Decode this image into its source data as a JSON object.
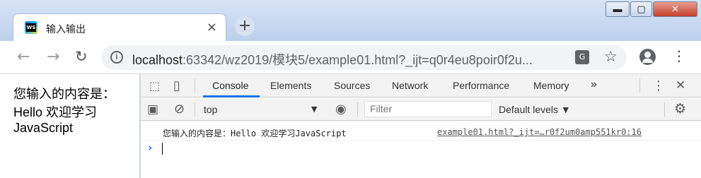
{
  "tab": {
    "title": "输入输出",
    "close": "×"
  },
  "window_controls": {
    "minimize": "▬",
    "maximize": "▢",
    "close": "✕"
  },
  "toolbar": {
    "url_host": "localhost",
    "url_rest": ":63342/wz2019/模块5/example01.html?_ijt=q0r4eu8poir0f2u...",
    "back": "←",
    "forward": "→",
    "reload": "↻",
    "new_tab": "+",
    "star": "☆",
    "menu": "⋮",
    "info": "i",
    "translate": "G"
  },
  "page": {
    "lines": [
      "您输入的内容是：",
      "Hello 欢迎学习",
      "JavaScript"
    ]
  },
  "devtools": {
    "tabs": [
      "Console",
      "Elements",
      "Sources",
      "Network",
      "Performance",
      "Memory"
    ],
    "more_tabs": "»",
    "context": "top",
    "context_arrow": "▼",
    "filter_placeholder": "Filter",
    "levels": "Default levels ▼",
    "kebab": "⋮",
    "close": "✕",
    "inspect_icon": "⬚",
    "device_icon": "▯",
    "sidebar_icon": "▣",
    "clear_icon": "⊘",
    "eye_icon": "◉",
    "gear_icon": "⚙",
    "console_message": "您输入的内容是：Hello 欢迎学习JavaScript",
    "console_source": "example01.html?_ijt=…r0f2um0amp551kr0:16",
    "prompt": "›"
  }
}
